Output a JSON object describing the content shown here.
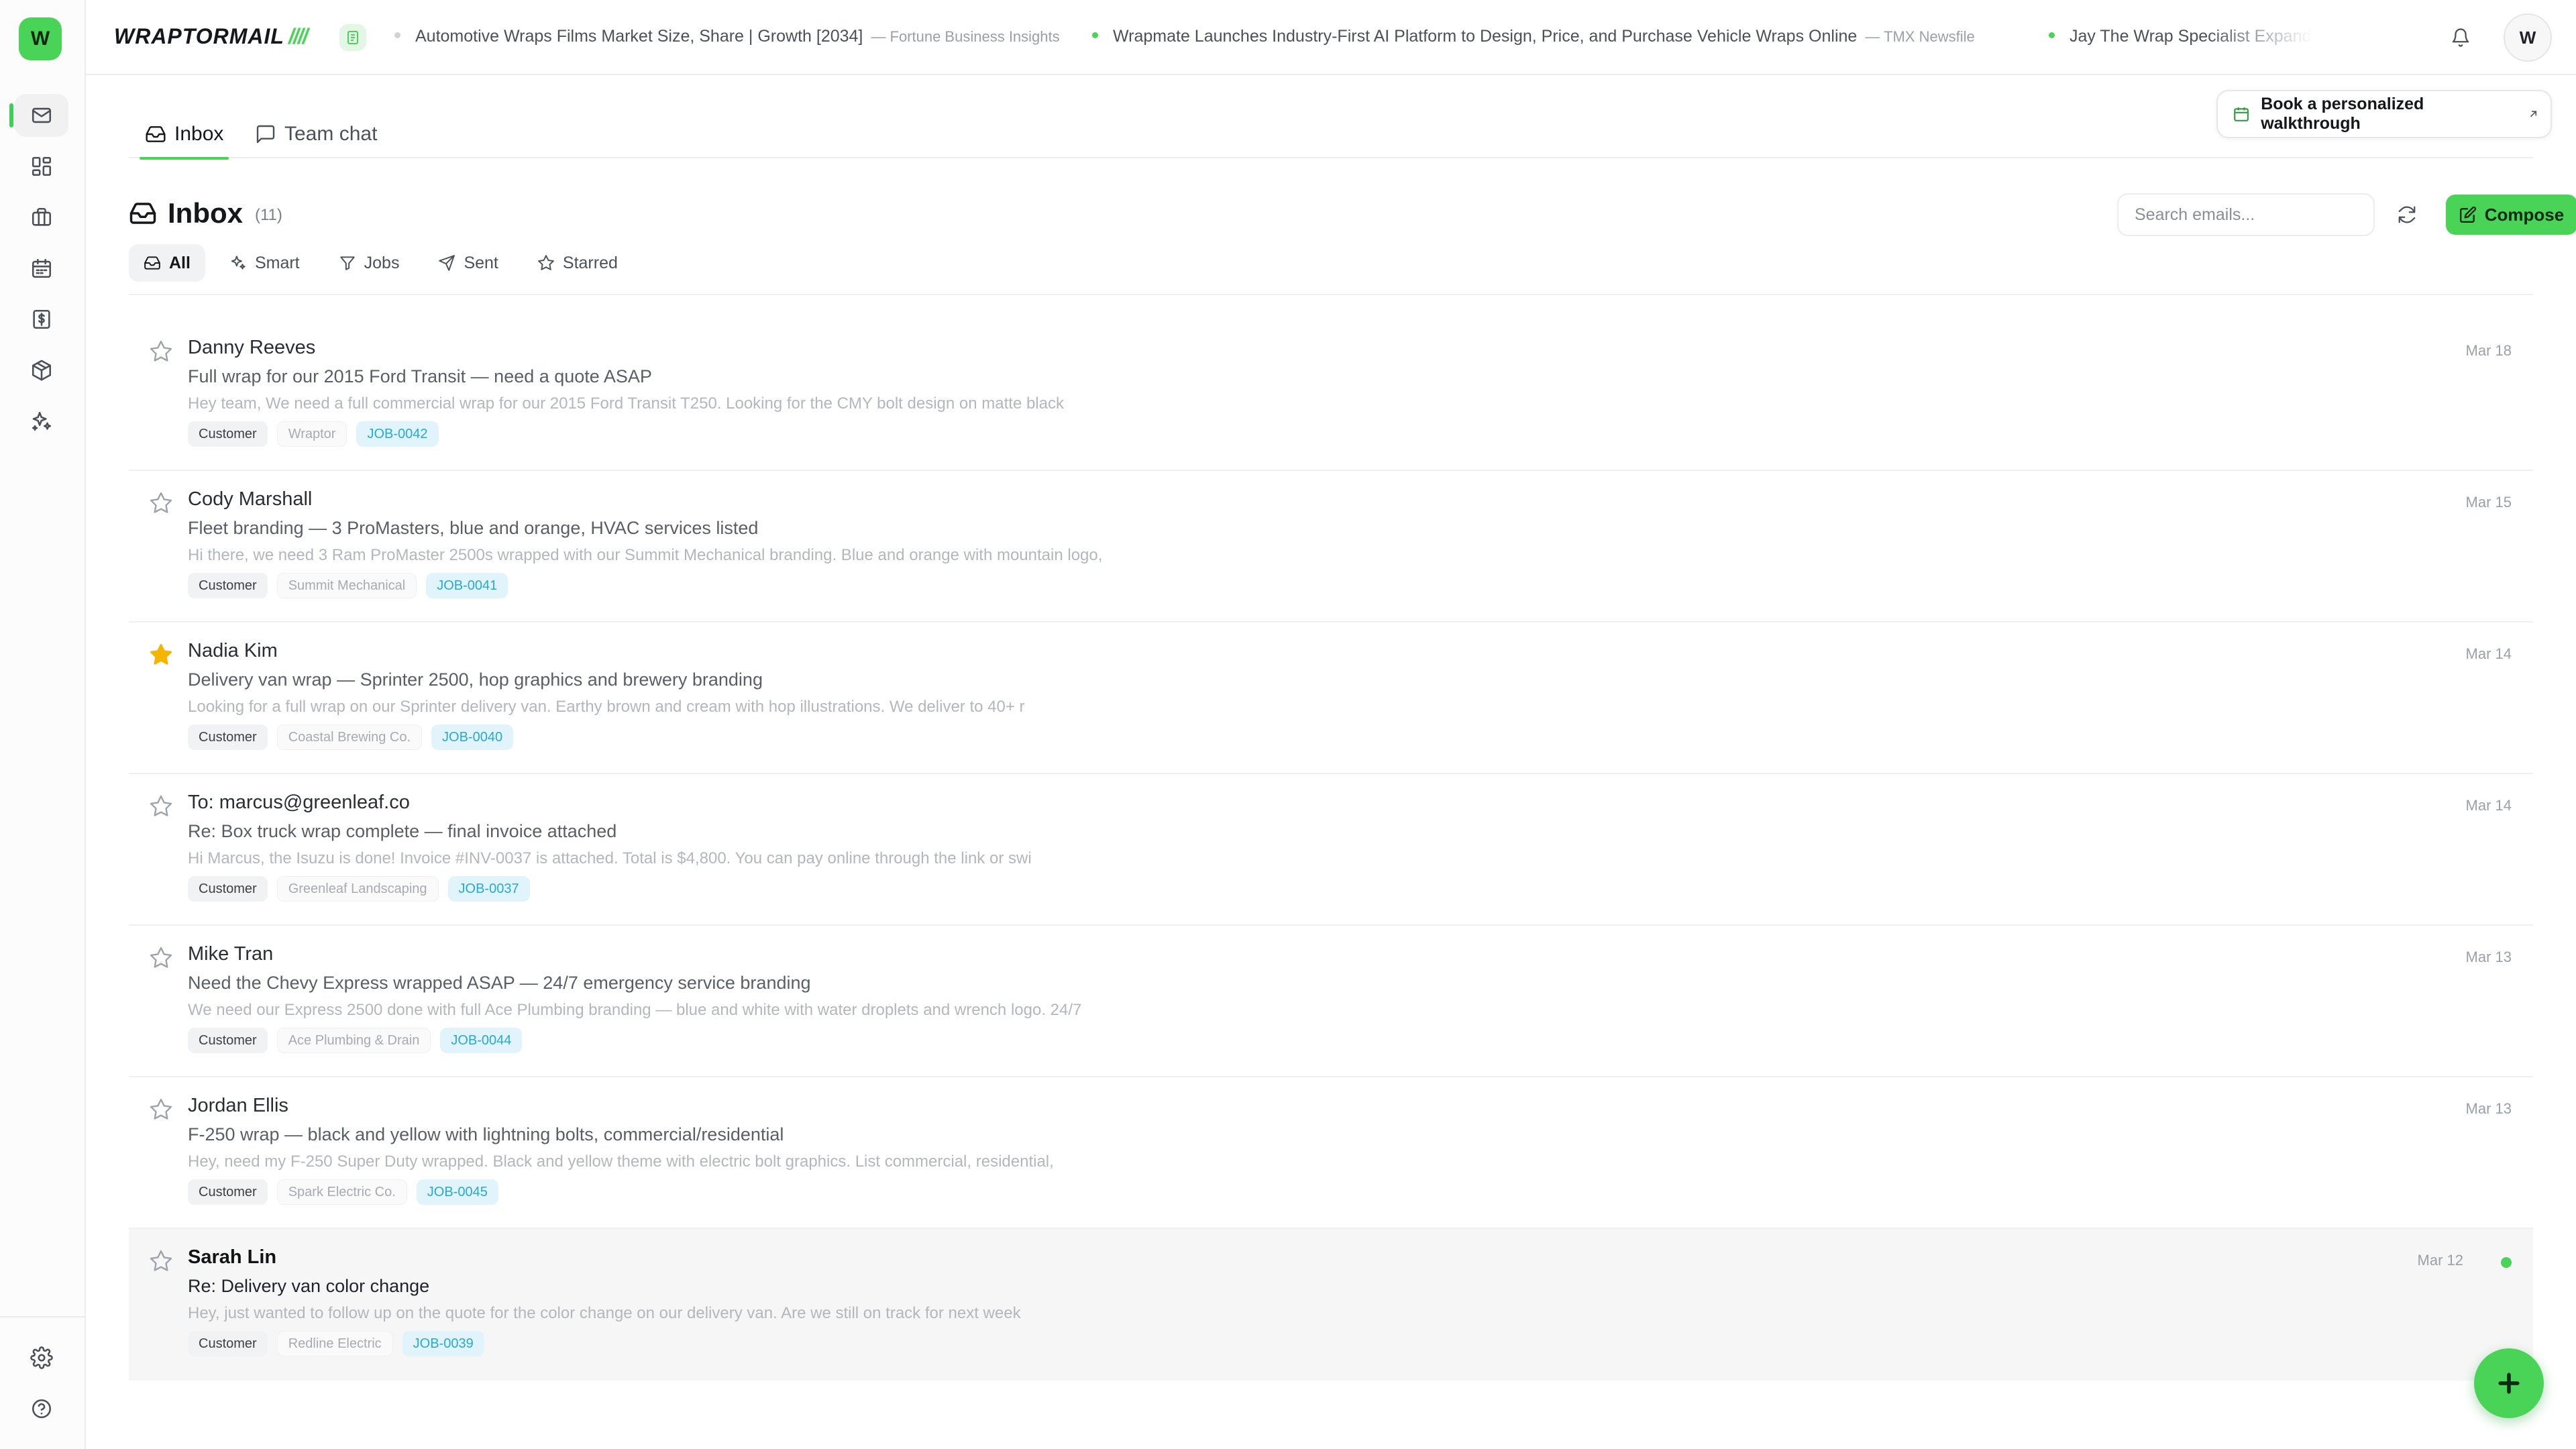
{
  "app": {
    "logo_letter": "W",
    "brand_name": "WRAPTORMAIL",
    "brand_slash": "////",
    "user_initial": "W"
  },
  "news": [
    {
      "title": "Automotive Wraps Films Market Size, Share | Growth [2034]",
      "source": "— Fortune Business Insights"
    },
    {
      "title": "Wrapmate Launches Industry-First AI Platform to Design, Price, and Purchase Vehicle Wraps Online",
      "source": "— TMX Newsfile"
    },
    {
      "title": "Jay The Wrap Specialist Expands Commercial Vehicle Wrap Services",
      "source": ""
    }
  ],
  "tabs": [
    {
      "label": "Inbox"
    },
    {
      "label": "Team chat"
    }
  ],
  "walkthrough_label": "Book a personalized walkthrough",
  "inbox": {
    "title": "Inbox",
    "count": "(11)",
    "search_placeholder": "Search emails...",
    "compose_label": "Compose"
  },
  "filters": [
    {
      "label": "All"
    },
    {
      "label": "Smart"
    },
    {
      "label": "Jobs"
    },
    {
      "label": "Sent"
    },
    {
      "label": "Starred"
    }
  ],
  "emails": [
    {
      "sender": "Danny Reeves",
      "subject": "Full wrap for our 2015 Ford Transit — need a quote ASAP",
      "preview": "Hey team, We need a full commercial wrap for our 2015 Ford Transit T250. Looking for the CMY bolt design on matte black",
      "kind": "Customer",
      "company": "Wraptor",
      "job": "JOB-0042",
      "date": "Mar 18",
      "starred": false
    },
    {
      "sender": "Cody Marshall",
      "subject": "Fleet branding — 3 ProMasters, blue and orange, HVAC services listed",
      "preview": "Hi there, we need 3 Ram ProMaster 2500s wrapped with our Summit Mechanical branding. Blue and orange with mountain logo,",
      "kind": "Customer",
      "company": "Summit Mechanical",
      "job": "JOB-0041",
      "date": "Mar 15",
      "starred": false
    },
    {
      "sender": "Nadia Kim",
      "subject": "Delivery van wrap — Sprinter 2500, hop graphics and brewery branding",
      "preview": "Looking for a full wrap on our Sprinter delivery van. Earthy brown and cream with hop illustrations. We deliver to 40+ r",
      "kind": "Customer",
      "company": "Coastal Brewing Co.",
      "job": "JOB-0040",
      "date": "Mar 14",
      "starred": true
    },
    {
      "sender": "To: marcus@greenleaf.co",
      "subject": "Re: Box truck wrap complete — final invoice attached",
      "preview": "Hi Marcus, the Isuzu is done! Invoice #INV-0037 is attached. Total is $4,800. You can pay online through the link or swi",
      "kind": "Customer",
      "company": "Greenleaf Landscaping",
      "job": "JOB-0037",
      "date": "Mar 14",
      "starred": false
    },
    {
      "sender": "Mike Tran",
      "subject": "Need the Chevy Express wrapped ASAP — 24/7 emergency service branding",
      "preview": "We need our Express 2500 done with full Ace Plumbing branding — blue and white with water droplets and wrench logo. 24/7",
      "kind": "Customer",
      "company": "Ace Plumbing & Drain",
      "job": "JOB-0044",
      "date": "Mar 13",
      "starred": false
    },
    {
      "sender": "Jordan Ellis",
      "subject": "F-250 wrap — black and yellow with lightning bolts, commercial/residential",
      "preview": "Hey, need my F-250 Super Duty wrapped. Black and yellow theme with electric bolt graphics. List commercial, residential,",
      "kind": "Customer",
      "company": "Spark Electric Co.",
      "job": "JOB-0045",
      "date": "Mar 13",
      "starred": false
    },
    {
      "sender": "Sarah Lin",
      "subject": "Re: Delivery van color change",
      "preview": "Hey, just wanted to follow up on the quote for the color change on our delivery van. Are we still on track for next week",
      "kind": "Customer",
      "company": "Redline Electric",
      "job": "JOB-0039",
      "date": "Mar 12",
      "starred": false,
      "unread": true
    }
  ],
  "colors": {
    "accent": "#49d458",
    "job_tag": "#27a9d4",
    "star": "#f4b400"
  }
}
